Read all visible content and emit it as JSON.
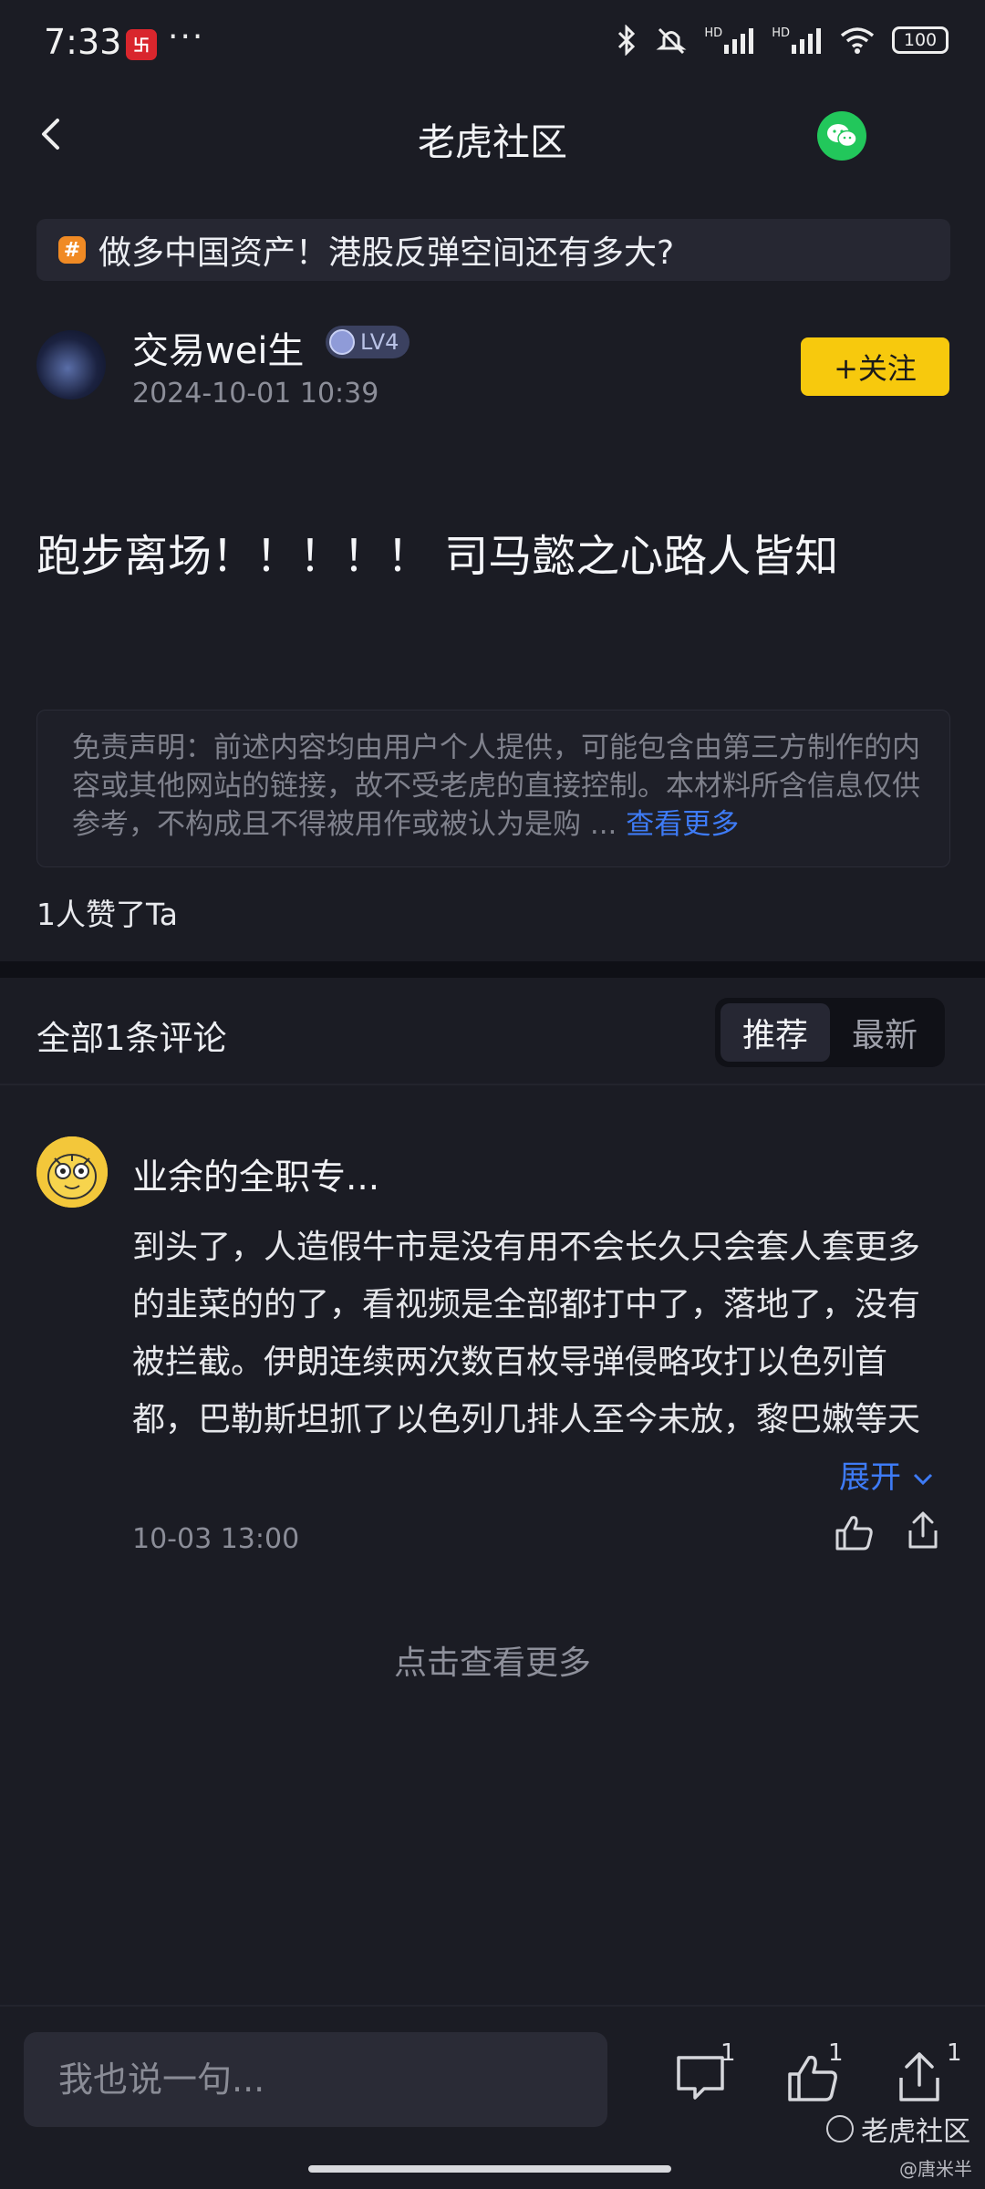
{
  "status_bar": {
    "time": "7:33",
    "app_badge": "卐",
    "more": "···",
    "signal_label_1": "HD",
    "signal_label_2": "HD",
    "battery": "100"
  },
  "header": {
    "title": "老虎社区"
  },
  "topic": {
    "hash": "#",
    "text": "做多中国资产！港股反弹空间还有多大?"
  },
  "author": {
    "name": "交易wei生",
    "level": "LV4",
    "time": "2024-10-01 10:39",
    "follow_label": "+关注"
  },
  "post": {
    "body": "跑步离场！！！！！ 司马懿之心路人皆知"
  },
  "disclaimer": {
    "text": "免责声明：前述内容均由用户个人提供，可能包含由第三方制作的内容或其他网站的链接，故不受老虎的直接控制。本材料所含信息仅供参考，不构成且不得被用作或被认为是购 ... ",
    "see_more": "查看更多"
  },
  "likes": {
    "text": "1人赞了Ta"
  },
  "comments": {
    "count_label": "全部1条评论",
    "sort_options": [
      "推荐",
      "最新"
    ],
    "items": [
      {
        "user": "业余的全职专...",
        "text": "到头了，人造假牛市是没有用不会长久只会套人套更多的韭菜的的了，看视频是全部都打中了，落地了，没有被拦截。伊朗连续两次数百枚导弹侵略攻打以色列首都，巴勒斯坦抓了以色列几排人至今未放，黎巴嫩等天",
        "expand_label": "展开",
        "time": "10-03 13:00"
      }
    ],
    "load_more": "点击查看更多"
  },
  "bottom_bar": {
    "input_placeholder": "我也说一句...",
    "comment_count": "1",
    "like_count": "1",
    "share_count": "1",
    "watermark": "老虎社区",
    "watermark_user": "@唐米半"
  },
  "colors": {
    "background": "#1b1c24",
    "accent_yellow": "#f7c90d",
    "link_blue": "#3e7bf6",
    "wechat_green": "#22c75b"
  }
}
